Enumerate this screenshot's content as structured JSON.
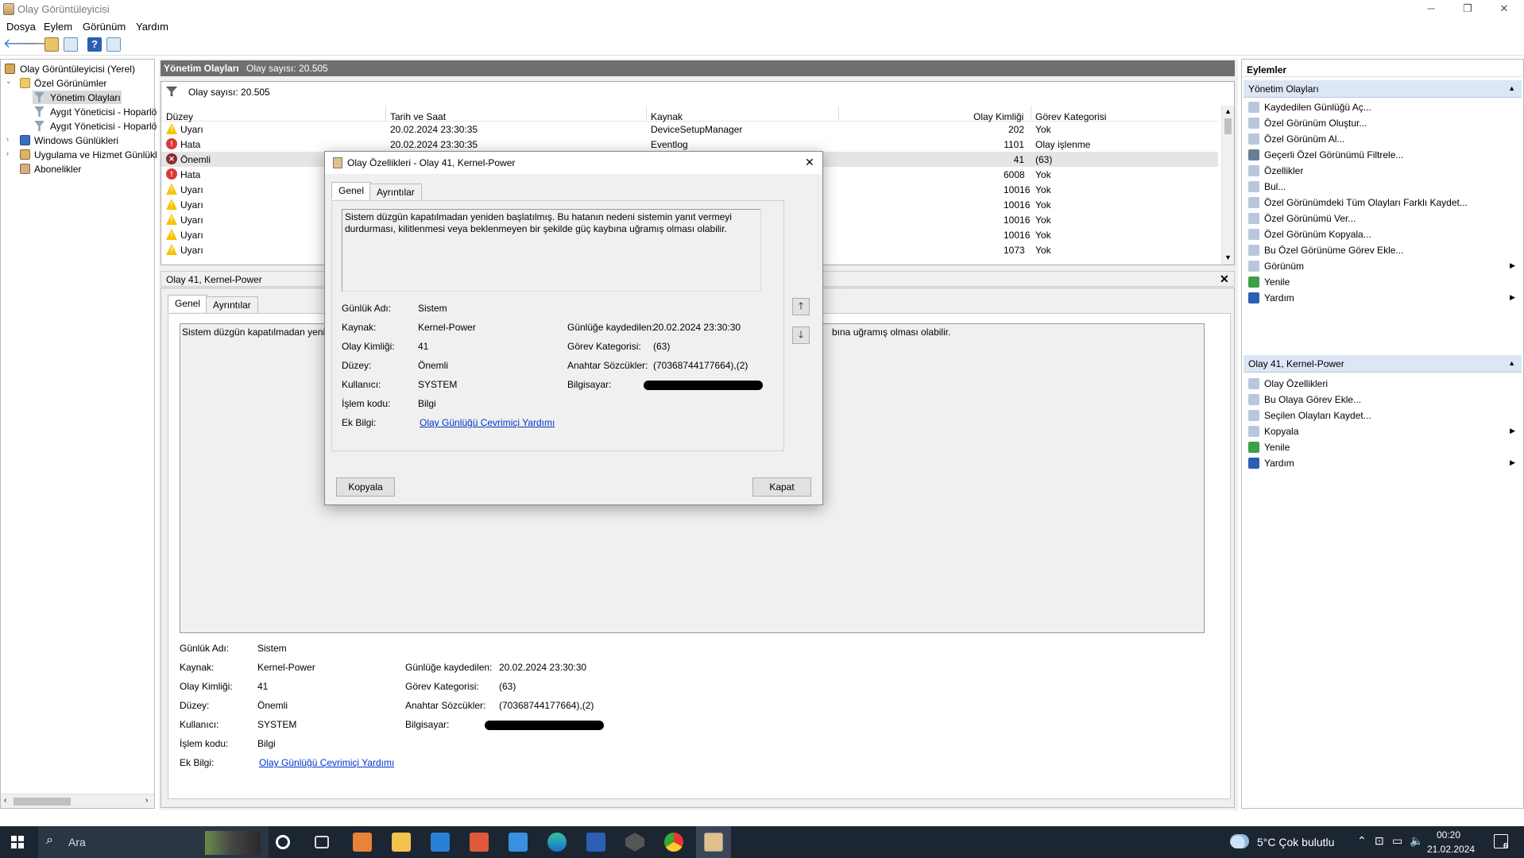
{
  "window": {
    "title": "Olay Görüntüleyicisi",
    "minimize": "─",
    "maximize": "❐",
    "close": "✕"
  },
  "menu": [
    "Dosya",
    "Eylem",
    "Görünüm",
    "Yardım"
  ],
  "tree": {
    "root": "Olay Görüntüleyicisi (Yerel)",
    "custom_views": "Özel Görünümler",
    "admin_events": "Yönetim Olayları",
    "device_mgr1": "Aygıt Yöneticisi - Hoparlö",
    "device_mgr2": "Aygıt Yöneticisi - Hoparlö",
    "windows_logs": "Windows Günlükleri",
    "app_service_logs": "Uygulama ve Hizmet Günlükl",
    "subscriptions": "Abonelikler"
  },
  "list_header": {
    "title": "Yönetim Olayları",
    "count": "Olay sayısı: 20.505"
  },
  "filter_count": "Olay sayısı: 20.505",
  "columns": {
    "level": "Düzey",
    "date": "Tarih ve Saat",
    "source": "Kaynak",
    "id": "Olay Kimliği",
    "task": "Görev Kategorisi"
  },
  "rows": [
    {
      "level": "Uyarı",
      "type": "warn",
      "date": "20.02.2024 23:30:35",
      "source": "DeviceSetupManager",
      "id": "202",
      "task": "Yok"
    },
    {
      "level": "Hata",
      "type": "error",
      "date": "20.02.2024 23:30:35",
      "source": "Eventlog",
      "id": "1101",
      "task": "Olay işlenme"
    },
    {
      "level": "Önemli",
      "type": "critical",
      "date": "",
      "source": "",
      "id": "41",
      "task": "(63)"
    },
    {
      "level": "Hata",
      "type": "error",
      "date": "",
      "source": "",
      "id": "6008",
      "task": "Yok"
    },
    {
      "level": "Uyarı",
      "type": "warn",
      "date": "",
      "source": "",
      "id": "10016",
      "task": "Yok"
    },
    {
      "level": "Uyarı",
      "type": "warn",
      "date": "",
      "source": "",
      "id": "10016",
      "task": "Yok"
    },
    {
      "level": "Uyarı",
      "type": "warn",
      "date": "",
      "source": "",
      "id": "10016",
      "task": "Yok"
    },
    {
      "level": "Uyarı",
      "type": "warn",
      "date": "",
      "source": "",
      "id": "10016",
      "task": "Yok"
    },
    {
      "level": "Uyarı",
      "type": "warn",
      "date": "",
      "source": "",
      "id": "1073",
      "task": "Yok"
    }
  ],
  "detail": {
    "title": "Olay 41, Kernel-Power",
    "tabs": [
      "Genel",
      "Ayrıntılar"
    ],
    "message_left": "Sistem düzgün kapatılmadan yeniden",
    "message_right": "bına uğramış olması olabilir.",
    "fields": {
      "log_name_label": "Günlük Adı:",
      "log_name": "Sistem",
      "source_label": "Kaynak:",
      "source": "Kernel-Power",
      "event_id_label": "Olay Kimliği:",
      "event_id": "41",
      "level_label": "Düzey:",
      "level": "Önemli",
      "user_label": "Kullanıcı:",
      "user": "SYSTEM",
      "opcode_label": "İşlem kodu:",
      "opcode": "Bilgi",
      "more_info_label": "Ek Bilgi:",
      "more_info_link": "Olay Günlüğü Çevrimiçi Yardımı",
      "logged_label": "Günlüğe kaydedilen:",
      "logged": "20.02.2024 23:30:30",
      "task_label": "Görev Kategorisi:",
      "task": "(63)",
      "keywords_label": "Anahtar Sözcükler:",
      "keywords": "(70368744177664),(2)",
      "computer_label": "Bilgisayar:"
    }
  },
  "dialog": {
    "title": "Olay Özellikleri - Olay 41, Kernel-Power",
    "tabs": [
      "Genel",
      "Ayrıntılar"
    ],
    "message": "Sistem düzgün kapatılmadan yeniden başlatılmış. Bu hatanın nedeni sistemin yanıt vermeyi durdurması, kilitlenmesi veya beklenmeyen bir şekilde güç kaybına uğramış olması olabilir.",
    "copy": "Kopyala",
    "close": "Kapat"
  },
  "actions": {
    "title": "Eylemler",
    "section1": "Yönetim Olayları",
    "items1": [
      "Kaydedilen Günlüğü Aç...",
      "Özel Görünüm Oluştur...",
      "Özel Görünüm Al...",
      "Geçerli Özel Görünümü Filtrele...",
      "Özellikler",
      "Bul...",
      "Özel Görünümdeki Tüm Olayları Farklı Kaydet...",
      "Özel Görünümü Ver...",
      "Özel Görünüm Kopyala...",
      "Bu Özel Görünüme Görev Ekle...",
      "Görünüm",
      "Yenile",
      "Yardım"
    ],
    "section2": "Olay 41, Kernel-Power",
    "items2": [
      "Olay Özellikleri",
      "Bu Olaya Görev Ekle...",
      "Seçilen Olayları Kaydet...",
      "Kopyala",
      "Yenile",
      "Yardım"
    ]
  },
  "taskbar": {
    "search": "Ara",
    "weather": "5°C  Çok bulutlu",
    "time": "00:20",
    "date": "21.02.2024",
    "notif": "6"
  }
}
